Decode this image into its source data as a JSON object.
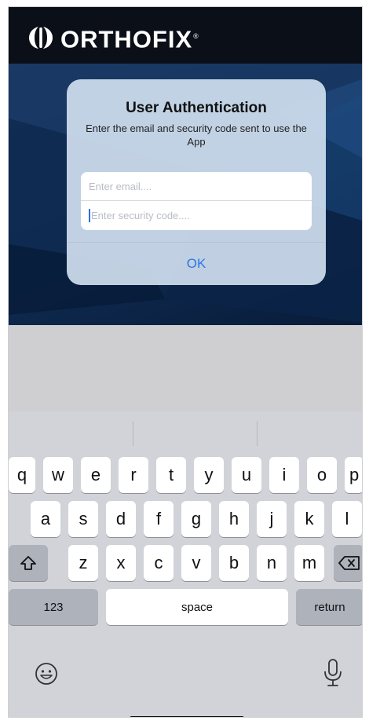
{
  "header": {
    "brand": "ORTHOFIX",
    "registered_mark": "®",
    "logo_icon": "orthofix-logo-mark"
  },
  "alert": {
    "title": "User Authentication",
    "message": "Enter the email and security code sent to use the App",
    "email_placeholder": "Enter email....",
    "code_placeholder": "Enter security code....",
    "ok_label": "OK"
  },
  "keyboard": {
    "rows": [
      [
        "q",
        "w",
        "e",
        "r",
        "t",
        "y",
        "u",
        "i",
        "o",
        "p"
      ],
      [
        "a",
        "s",
        "d",
        "f",
        "g",
        "h",
        "j",
        "k",
        "l"
      ],
      [
        "z",
        "x",
        "c",
        "v",
        "b",
        "n",
        "m"
      ]
    ],
    "numbers_label": "123",
    "space_label": "space",
    "return_label": "return",
    "shift_icon": "shift-icon",
    "delete_icon": "backspace-icon",
    "emoji_icon": "emoji-icon",
    "dictation_icon": "microphone-icon"
  },
  "colors": {
    "accent": "#2a78e4",
    "header_bg": "#0b0f18",
    "background_blue": "#123058"
  }
}
